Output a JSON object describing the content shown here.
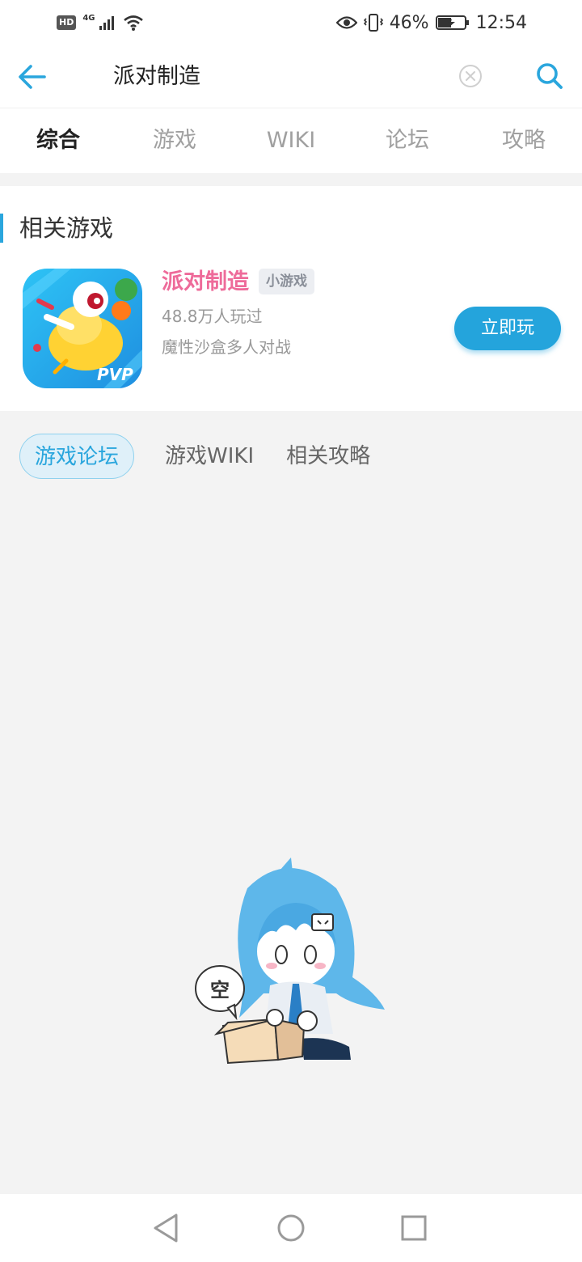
{
  "status_bar": {
    "hd": "HD",
    "network": "4G",
    "battery": "46%",
    "time": "12:54"
  },
  "header": {
    "search_value": "派对制造"
  },
  "tabs": [
    {
      "label": "综合",
      "active": true
    },
    {
      "label": "游戏",
      "active": false
    },
    {
      "label": "WIKI",
      "active": false
    },
    {
      "label": "论坛",
      "active": false
    },
    {
      "label": "攻略",
      "active": false
    }
  ],
  "related": {
    "title": "相关游戏",
    "game": {
      "name": "派对制造",
      "tag": "小游戏",
      "plays": "48.8万人玩过",
      "desc": "魔性沙盒多人对战",
      "icon_text": "PVP",
      "play_label": "立即玩"
    }
  },
  "subtabs": [
    {
      "label": "游戏论坛",
      "active": true
    },
    {
      "label": "游戏WIKI",
      "active": false
    },
    {
      "label": "相关攻略",
      "active": false
    }
  ],
  "empty": {
    "bubble_text": "空"
  },
  "colors": {
    "accent": "#24a4dc",
    "game_name": "#ee6b9a",
    "page_bg": "#f3f3f3"
  }
}
